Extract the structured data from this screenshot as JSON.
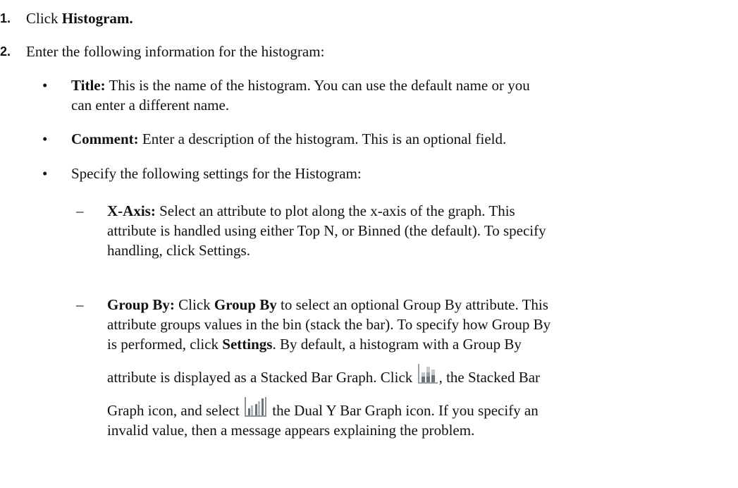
{
  "steps": [
    {
      "number": "1.",
      "prefix": "Click ",
      "bold": "Histogram."
    },
    {
      "number": "2.",
      "text": "Enter the following information for the histogram:"
    }
  ],
  "bullets": {
    "mark": "•",
    "title": {
      "label": "Title:",
      "line1": " This is the name of the histogram. You can use the default name or you",
      "line2": "can enter a different name."
    },
    "comment": {
      "label": "Comment:",
      "text": " Enter a description of the histogram. This is an optional field."
    },
    "settings": {
      "text": "Specify the following settings for the Histogram:"
    }
  },
  "dash_items": {
    "mark": "–",
    "xaxis": {
      "label": "X-Axis:",
      "line1": " Select an attribute to plot along the x-axis of the graph. This",
      "line2": "attribute is handled using either Top N, or Binned (the default). To specify",
      "line3": "handling, click Settings."
    },
    "groupby": {
      "label": "Group By:",
      "l1_a": " Click ",
      "l1_bold": "Group By",
      "l1_b": " to select an optional Group By attribute. This",
      "line2": "attribute groups values in the bin (stack the bar). To specify how Group By",
      "l3_a": "is performed, click ",
      "l3_bold": "Settings",
      "l3_b": ". By default, a histogram with a Group By",
      "l4_a": "attribute is displayed as a Stacked Bar Graph. Click ",
      "l4_b": ", the Stacked Bar",
      "l5_a": "Graph icon, and select ",
      "l5_b": " the Dual Y Bar Graph icon. If you specify an",
      "line6": "invalid value, then a message appears explaining the problem."
    }
  },
  "icons": {
    "stacked_bar": "stacked-bar-graph-icon",
    "dual_y_bar": "dual-y-bar-graph-icon"
  }
}
